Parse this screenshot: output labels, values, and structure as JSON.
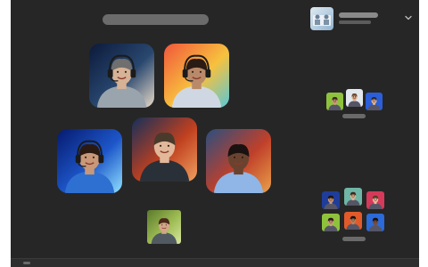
{
  "app": {
    "background_color": "#262626",
    "placeholder_color": "#6b6b6b"
  },
  "main_participants": [
    {
      "bg": [
        "#0b1a3a",
        "#29476f",
        "#e7dac8"
      ],
      "skin": "#d6b296",
      "hair": "#6f6f6f",
      "shirt": "#9aa4ad",
      "headset": true
    },
    {
      "bg": [
        "#f1563b",
        "#f7c13e",
        "#5ac8d8"
      ],
      "skin": "#b98a6a",
      "hair": "#2a1c14",
      "shirt": "#cfd8e2",
      "headset": true
    },
    {
      "bg": [
        "#061a6e",
        "#1d56c9",
        "#8fe0ff"
      ],
      "skin": "#c99878",
      "hair": "#2b1a12",
      "shirt": "#2e6fd2",
      "headset": true
    },
    {
      "bg": [
        "#15305a",
        "#c0401f",
        "#f0a060"
      ],
      "skin": "#e2b89a",
      "hair": "#4a3a2c",
      "shirt": "#2a3038",
      "headset": false
    },
    {
      "bg": [
        "#2b4f7f",
        "#c0402a",
        "#eaa04a"
      ],
      "skin": "#6a4330",
      "hair": "#1a1210",
      "shirt": "#8fb6e6",
      "headset": false
    },
    {
      "bg": [
        "#5a7a2a",
        "#9fbd55",
        "#d8e6a0"
      ],
      "skin": "#d2a688",
      "hair": "#4a2a1a",
      "shirt": "#505a60",
      "headset": false
    }
  ],
  "group_top": [
    {
      "bg": "#8fc23c",
      "skin": "#c79c7c",
      "hair": "#3a2418"
    },
    {
      "bg": "#e3e8ee",
      "skin": "#d7b08e",
      "hair": "#6b4a30"
    },
    {
      "bg": "#2b5ed8",
      "skin": "#e0b898",
      "hair": "#2a2a2a"
    }
  ],
  "group_bottom": [
    {
      "bg": "#1f3d9a",
      "skin": "#c7997a",
      "hair": "#1c1410"
    },
    {
      "bg": "#6fb6a6",
      "skin": "#d9b393",
      "hair": "#3b2a1e"
    },
    {
      "bg": "#d63a5a",
      "skin": "#e6bfa0",
      "hair": "#5a3a22"
    },
    {
      "bg": "#8fc23c",
      "skin": "#c79c7c",
      "hair": "#2a1a10"
    },
    {
      "bg": "#e25a2a",
      "skin": "#b7825e",
      "hair": "#1a1210"
    },
    {
      "bg": "#2b6ad8",
      "skin": "#7a4e38",
      "hair": "#121010"
    }
  ]
}
